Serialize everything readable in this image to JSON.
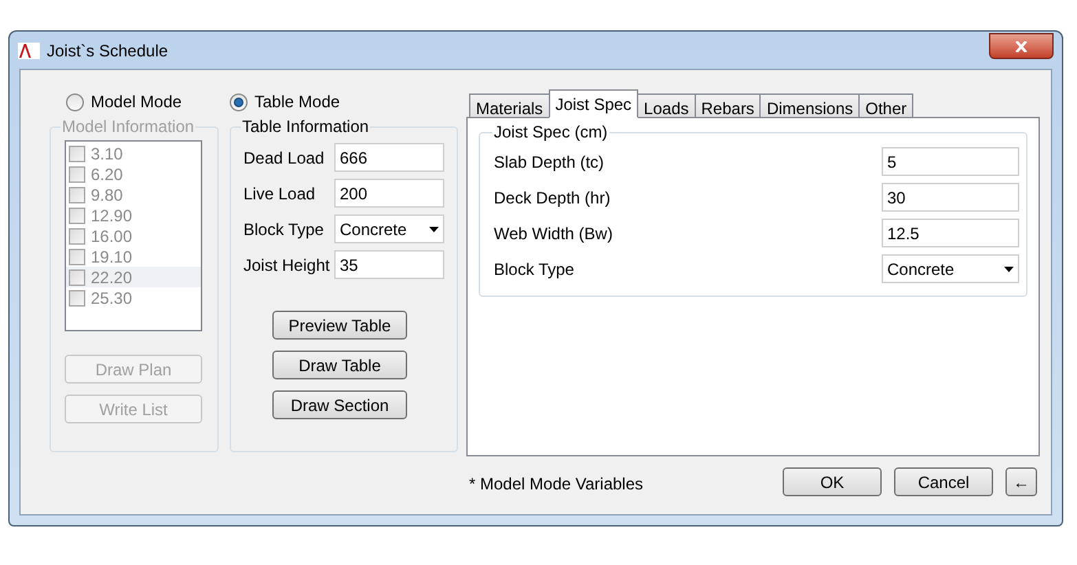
{
  "window": {
    "title": "Joist`s Schedule"
  },
  "modes": [
    {
      "label": "Model Mode",
      "selected": false
    },
    {
      "label": "Table Mode",
      "selected": true
    }
  ],
  "model_info": {
    "title": "Model Information",
    "disabled": true,
    "items": [
      {
        "label": "3.10",
        "checked": false,
        "selected": false
      },
      {
        "label": "6.20",
        "checked": false,
        "selected": false
      },
      {
        "label": "9.80",
        "checked": false,
        "selected": false
      },
      {
        "label": "12.90",
        "checked": false,
        "selected": false
      },
      {
        "label": "16.00",
        "checked": false,
        "selected": false
      },
      {
        "label": "19.10",
        "checked": false,
        "selected": false
      },
      {
        "label": "22.20",
        "checked": false,
        "selected": true
      },
      {
        "label": "25.30",
        "checked": false,
        "selected": false
      }
    ],
    "buttons": [
      "Draw Plan",
      "Write List"
    ]
  },
  "table_info": {
    "title": "Table Information",
    "fields": [
      {
        "kind": "text",
        "label": "Dead Load",
        "value": "666"
      },
      {
        "kind": "text",
        "label": "Live Load",
        "value": "200"
      },
      {
        "kind": "select",
        "label": "Block Type",
        "value": "Concrete"
      },
      {
        "kind": "text",
        "label": "Joist Height",
        "value": "35"
      }
    ],
    "buttons": [
      "Preview Table",
      "Draw Table",
      "Draw Section"
    ]
  },
  "tabs": [
    {
      "label": "Materials",
      "selected": false
    },
    {
      "label": "Joist Spec",
      "selected": true
    },
    {
      "label": "Loads",
      "selected": false
    },
    {
      "label": "Rebars",
      "selected": false
    },
    {
      "label": "Dimensions",
      "selected": false
    },
    {
      "label": "Other",
      "selected": false
    }
  ],
  "joist_spec": {
    "title": "Joist Spec (cm)",
    "fields": [
      {
        "kind": "text",
        "label": "Slab Depth (tc)",
        "value": "5"
      },
      {
        "kind": "text",
        "label": "Deck Depth (hr)",
        "value": "30"
      },
      {
        "kind": "text",
        "label": "Web Width (Bw)",
        "value": "12.5"
      },
      {
        "kind": "select",
        "label": "Block Type",
        "value": "Concrete"
      }
    ]
  },
  "footnote": "* Model Mode Variables",
  "buttons": [
    "OK",
    "Cancel",
    "←"
  ]
}
